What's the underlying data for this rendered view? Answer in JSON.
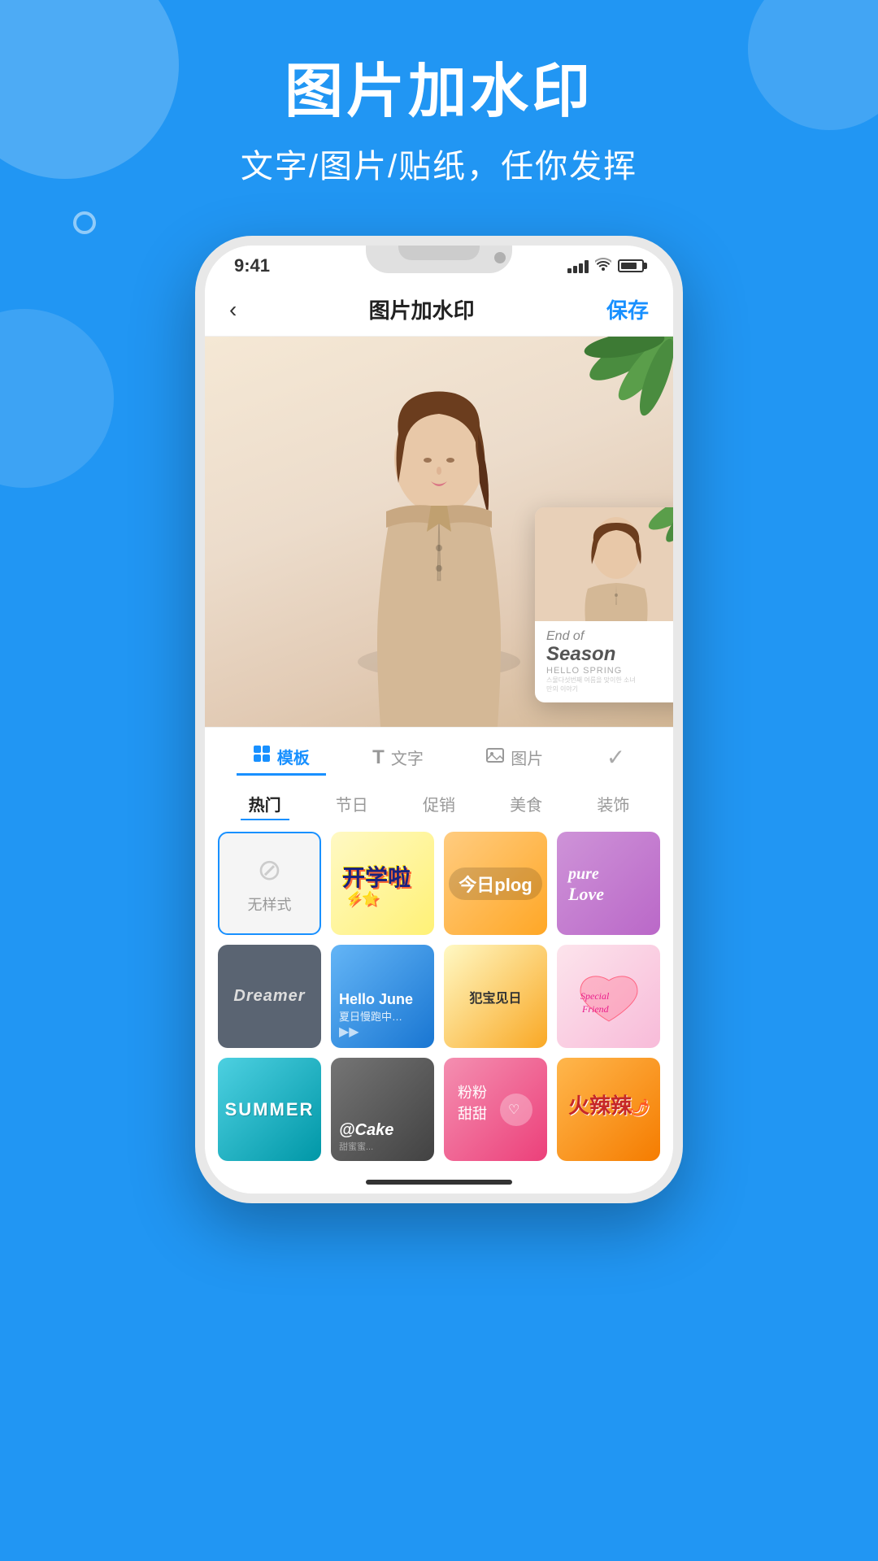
{
  "app": {
    "background_color": "#2196F3"
  },
  "hero": {
    "title": "图片加水印",
    "subtitle": "文字/图片/贴纸，任你发挥"
  },
  "status_bar": {
    "time": "9:41",
    "signal": "4 bars",
    "wifi": true,
    "battery": "full"
  },
  "header": {
    "back_label": "‹",
    "title": "图片加水印",
    "save_label": "保存"
  },
  "tabs": [
    {
      "id": "template",
      "icon": "⊞",
      "label": "模板",
      "active": true
    },
    {
      "id": "text",
      "icon": "T",
      "label": "文字",
      "active": false
    },
    {
      "id": "image",
      "icon": "⬜",
      "label": "图片",
      "active": false
    },
    {
      "id": "check",
      "icon": "✓",
      "label": "",
      "active": false
    }
  ],
  "categories": [
    {
      "id": "hot",
      "label": "热门",
      "active": true
    },
    {
      "id": "holiday",
      "label": "节日",
      "active": false
    },
    {
      "id": "promo",
      "label": "促销",
      "active": false
    },
    {
      "id": "food",
      "label": "美食",
      "active": false
    },
    {
      "id": "deco",
      "label": "装饰",
      "active": false
    }
  ],
  "templates": [
    {
      "id": "no-style",
      "label": "无样式",
      "type": "no-style"
    },
    {
      "id": "school",
      "label": "开学啦",
      "type": "school"
    },
    {
      "id": "plog",
      "label": "今日plog",
      "type": "plog"
    },
    {
      "id": "love",
      "label": "pureLove",
      "type": "love"
    },
    {
      "id": "dreamer",
      "label": "Dreamer",
      "type": "dreamer"
    },
    {
      "id": "hello-june",
      "label": "Hello June",
      "type": "hello-june"
    },
    {
      "id": "today",
      "label": "犯宝见日",
      "type": "today"
    },
    {
      "id": "special",
      "label": "Special Friend",
      "type": "special"
    },
    {
      "id": "summer",
      "label": "SUMMER",
      "type": "summer"
    },
    {
      "id": "cake",
      "label": "@Cake",
      "type": "cake"
    },
    {
      "id": "pink",
      "label": "粉粉甜甜",
      "type": "pink"
    },
    {
      "id": "hot-chili",
      "label": "火辣辣",
      "type": "hot"
    }
  ],
  "preview_card": {
    "end_text": "End of",
    "season_text": "Season",
    "hello_text": "HELLO SPRING",
    "small_text1": "스물다섯번째 여름을 맞이한 소녀",
    "small_text2": "만의 이야기"
  }
}
